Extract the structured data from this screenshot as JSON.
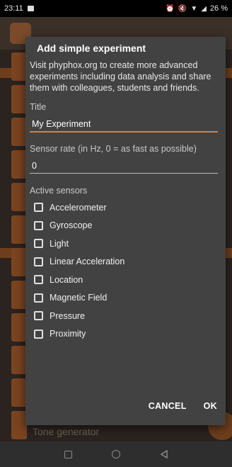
{
  "status_bar": {
    "time": "23:11",
    "battery": "26 %",
    "icons": [
      "notification-icon",
      "alarm-icon",
      "mute-icon",
      "wifi-icon",
      "signal-icon",
      "battery-icon"
    ]
  },
  "background": {
    "bottom_item": "Tone generator"
  },
  "dialog": {
    "title": "Add simple experiment",
    "description": "Visit phyphox.org to create more advanced experiments including data analysis and share them with colleagues, students and friends.",
    "title_field": {
      "label": "Title",
      "value": "My Experiment"
    },
    "rate_field": {
      "label": "Sensor rate (in Hz, 0 = as fast as possible)",
      "value": "0"
    },
    "sensors_label": "Active sensors",
    "sensors": [
      {
        "label": "Accelerometer",
        "checked": false
      },
      {
        "label": "Gyroscope",
        "checked": false
      },
      {
        "label": "Light",
        "checked": false
      },
      {
        "label": "Linear Acceleration",
        "checked": false
      },
      {
        "label": "Location",
        "checked": false
      },
      {
        "label": "Magnetic Field",
        "checked": false
      },
      {
        "label": "Pressure",
        "checked": false
      },
      {
        "label": "Proximity",
        "checked": false
      }
    ],
    "cancel_label": "CANCEL",
    "ok_label": "OK"
  },
  "colors": {
    "accent": "#e57c2b",
    "dialog_bg": "#424242"
  }
}
